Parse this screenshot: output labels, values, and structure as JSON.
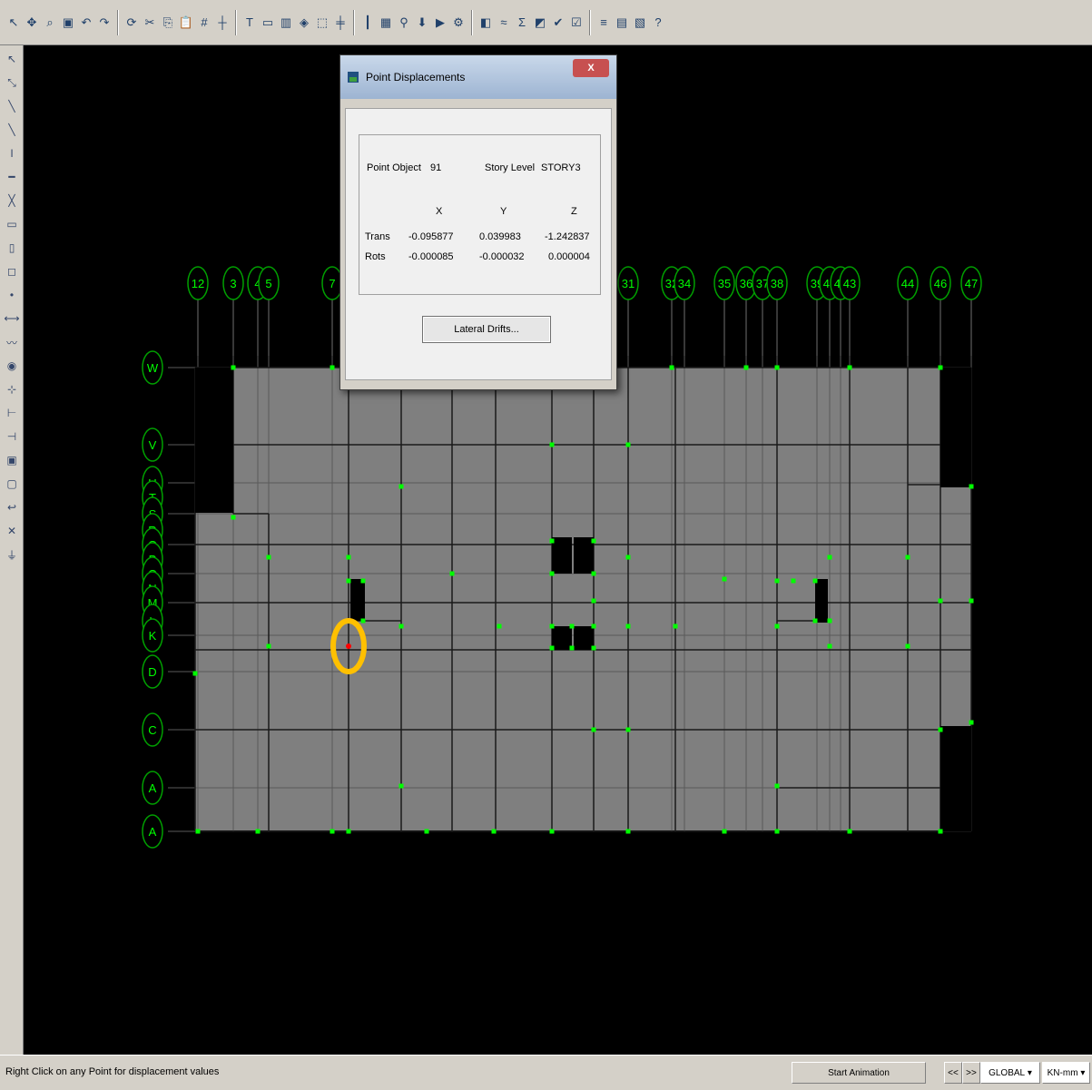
{
  "toolbar": {
    "icons": [
      "pointer-icon",
      "pan-icon",
      "zoom-icon",
      "save-icon",
      "undo-icon",
      "redo-icon",
      "refresh-icon",
      "cut-icon",
      "copy-icon",
      "paste-icon",
      "grid-icon",
      "axis-icon",
      "text-icon",
      "plan-icon",
      "elevation-icon",
      "3d-icon",
      "select-icon",
      "section-icon",
      "frame-icon",
      "area-icon",
      "link-icon",
      "load-icon",
      "analyze-icon",
      "run-icon",
      "display-icon",
      "deform-icon",
      "force-icon",
      "stress-icon",
      "design-icon",
      "check-icon",
      "summary-icon",
      "table-icon",
      "report-icon",
      "help-icon"
    ]
  },
  "left_toolbar": {
    "icons": [
      "pointer-icon",
      "reshape-icon",
      "line-icon",
      "line-icon",
      "column-icon",
      "beam-icon",
      "brace-icon",
      "area-icon",
      "wall-icon",
      "opening-icon",
      "point-icon",
      "link-icon",
      "spring-icon",
      "joint-icon",
      "snap-icon",
      "snap-end-icon",
      "snap-mid-icon",
      "select-all-icon",
      "deselect-icon",
      "previous-icon",
      "clear-icon",
      "restraint-icon"
    ]
  },
  "grid_x": [
    "12",
    "3",
    "4",
    "5",
    "7",
    "31",
    "32",
    "34",
    "35",
    "36",
    "37",
    "38",
    "39",
    "40",
    "42",
    "43",
    "44",
    "46",
    "47"
  ],
  "grid_y": [
    "W",
    "V",
    "U",
    "T",
    "S",
    "R",
    "Q",
    "P",
    "O",
    "N",
    "M",
    "L",
    "K",
    "D",
    "C",
    "A"
  ],
  "dialog": {
    "title": "Point Displacements",
    "close": "X",
    "point_object_label": "Point Object",
    "point_object_value": "91",
    "story_label": "Story Level",
    "story_value": "STORY3",
    "col_x": "X",
    "col_y": "Y",
    "col_z": "Z",
    "row_trans": "Trans",
    "row_rots": "Rots",
    "trans_x": "-0.095877",
    "trans_y": "0.039983",
    "trans_z": "-1.242837",
    "rots_x": "-0.000085",
    "rots_y": "-0.000032",
    "rots_z": "0.000004",
    "button": "Lateral Drifts..."
  },
  "status": {
    "message": "Right Click on any Point for displacement values",
    "start_animation": "Start Animation",
    "prev": "<<",
    "next": ">>",
    "coord_system": "GLOBAL",
    "units": "KN-mm"
  },
  "colors": {
    "canvas": "#000000",
    "slab": "#808080",
    "grid_bubble": "#00ff00",
    "joint": "#00ff00",
    "selection": "#ffc000"
  }
}
